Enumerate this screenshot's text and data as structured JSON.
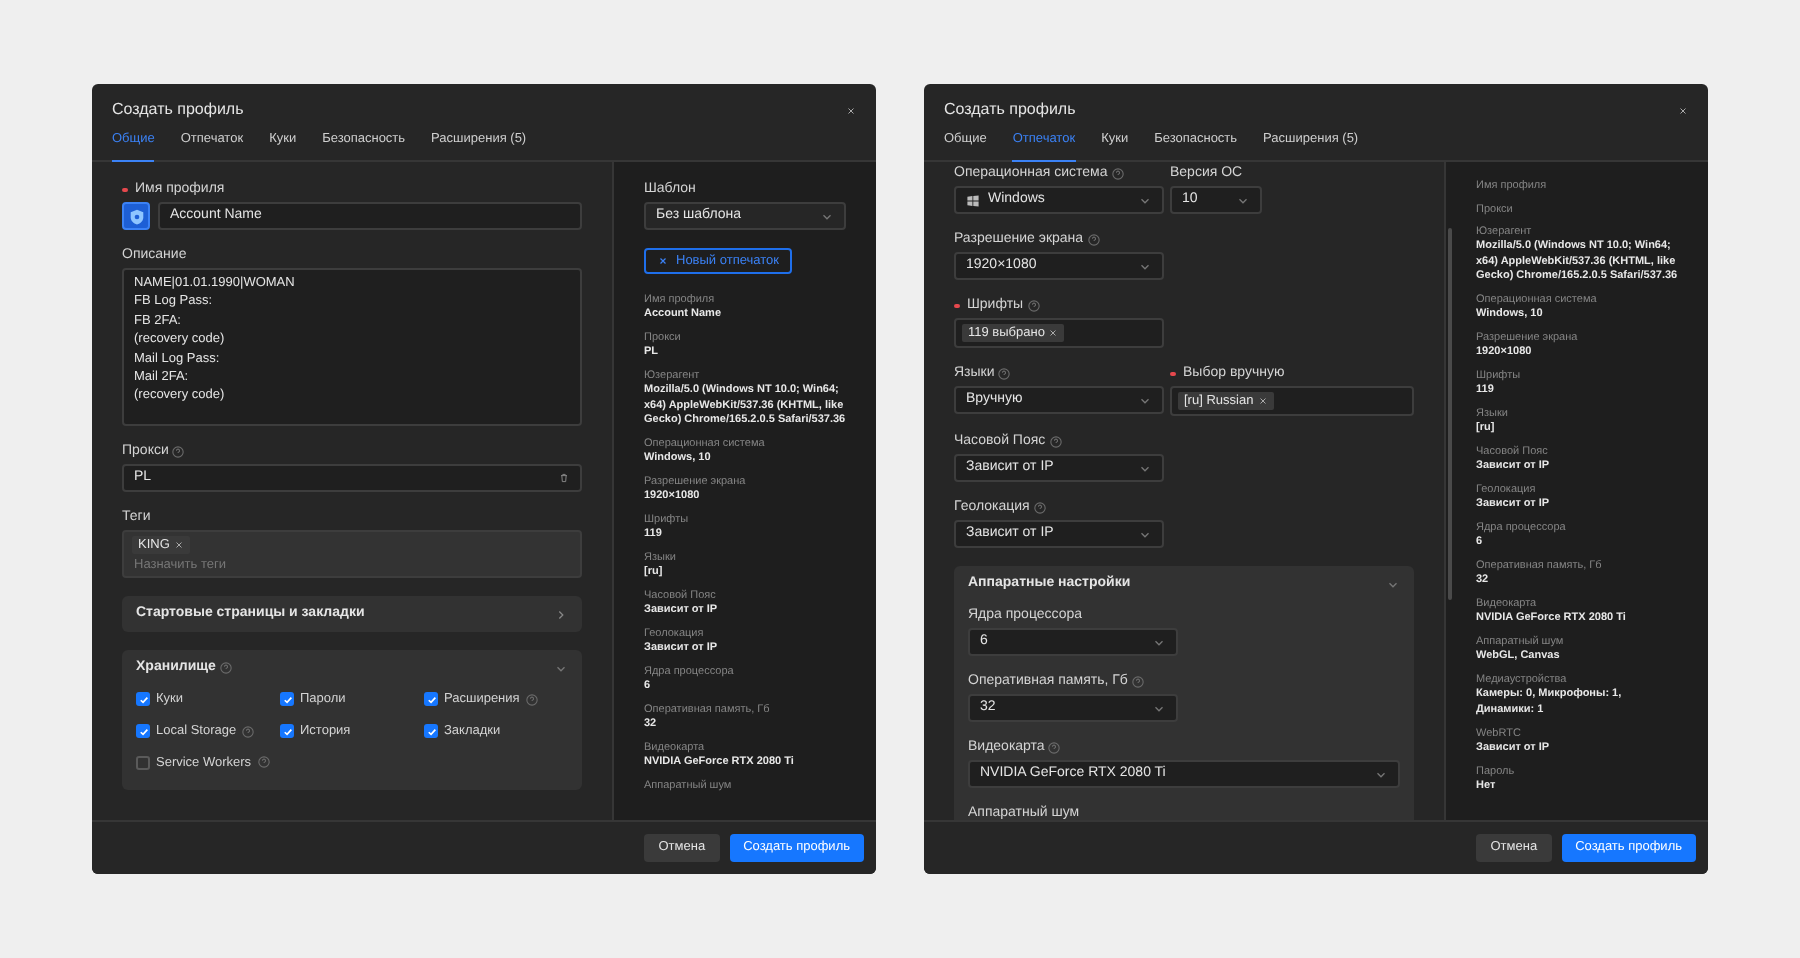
{
  "dialogs": [
    {
      "title": "Создать профиль",
      "tabs": [
        {
          "label": "Общие",
          "selected": true
        },
        {
          "label": "Отпечаток",
          "selected": false
        },
        {
          "label": "Куки",
          "selected": false
        },
        {
          "label": "Безопасность",
          "selected": false
        },
        {
          "label": "Расширения (5)",
          "selected": false
        }
      ],
      "form": [
        [
          {
            "kind": "profile-name",
            "label": "Имя профиля",
            "required": true,
            "value": "Account Name"
          }
        ],
        [
          {
            "kind": "textarea",
            "label": "Описание",
            "value": "NAME|01.01.1990|WOMAN\nFB Log Pass:\nFB 2FA:\n(recovery code)\nMail Log Pass:\nMail 2FA:\n(recovery code)"
          }
        ],
        [
          {
            "kind": "proxy",
            "label": "Прокси",
            "help": true,
            "value": "PL"
          }
        ],
        [
          {
            "kind": "tags",
            "label": "Теги",
            "tags": [
              "KING"
            ],
            "placeholder": "Назначить теги"
          }
        ],
        [
          {
            "kind": "section",
            "title": "Стартовые страницы и закладки",
            "expanded": false
          }
        ],
        [
          {
            "kind": "section",
            "title": "Хранилище",
            "help": true,
            "expanded": true,
            "checkboxes": [
              {
                "label": "Куки",
                "checked": true
              },
              {
                "label": "Пароли",
                "checked": true
              },
              {
                "label": "Расширения",
                "checked": true,
                "help": true
              },
              {
                "label": "Local Storage",
                "checked": true,
                "help": true
              },
              {
                "label": "История",
                "checked": true
              },
              {
                "label": "Закладки",
                "checked": true
              },
              {
                "label": "Service Workers",
                "checked": false,
                "help": true
              }
            ]
          }
        ]
      ],
      "summary": {
        "template": {
          "label": "Шаблон",
          "value": "Без шаблона"
        },
        "new_fingerprint_button": "Новый отпечаток",
        "items": [
          {
            "label": "Имя профиля",
            "value": "Account Name"
          },
          {
            "label": "Прокси",
            "value": "PL"
          },
          {
            "label": "Юзерагент",
            "value": "Mozilla/5.0 (Windows NT 10.0; Win64; x64) AppleWebKit/537.36 (KHTML, like Gecko) Chrome/165.2.0.5 Safari/537.36"
          },
          {
            "label": "Операционная система",
            "value": "Windows, 10"
          },
          {
            "label": "Разрешение экрана",
            "value": "1920×1080"
          },
          {
            "label": "Шрифты",
            "value": "119"
          },
          {
            "label": "Языки",
            "value": "[ru]"
          },
          {
            "label": "Часовой Пояс",
            "value": "Зависит от IP"
          },
          {
            "label": "Геолокация",
            "value": "Зависит от IP"
          },
          {
            "label": "Ядра процессора",
            "value": "6"
          },
          {
            "label": "Оперативная память, Гб",
            "value": "32"
          },
          {
            "label": "Видеокарта",
            "value": "NVIDIA GeForce RTX 2080 Ti"
          },
          {
            "label": "Аппаратный шум"
          }
        ]
      },
      "buttons": [
        {
          "label": "Отмена",
          "kind": "secondary"
        },
        {
          "label": "Создать профиль",
          "kind": "primary"
        }
      ]
    },
    {
      "title": "Создать профиль",
      "tabs": [
        {
          "label": "Общие",
          "selected": false
        },
        {
          "label": "Отпечаток",
          "selected": true
        },
        {
          "label": "Куки",
          "selected": false
        },
        {
          "label": "Безопасность",
          "selected": false
        },
        {
          "label": "Расширения (5)",
          "selected": false
        }
      ],
      "form": [
        [
          {
            "kind": "select-os",
            "label": "Операционная система",
            "help": true,
            "value": "Windows"
          },
          {
            "kind": "select-small",
            "label": "Версия ОС",
            "value": "10"
          }
        ],
        [
          {
            "kind": "select",
            "label": "Разрешение экрана",
            "help": true,
            "value": "1920×1080"
          }
        ],
        [
          {
            "kind": "tag-select",
            "label": "Шрифты",
            "required": true,
            "help": true,
            "tags": [
              "119 выбрано"
            ]
          }
        ],
        [
          {
            "kind": "select",
            "label": "Языки",
            "help": true,
            "value": "Вручную"
          },
          {
            "kind": "tag-select",
            "label": "Выбор вручную",
            "required": true,
            "tags": [
              "[ru] Russian"
            ]
          }
        ],
        [
          {
            "kind": "select",
            "label": "Часовой Пояс",
            "help": true,
            "value": "Зависит от IP"
          }
        ],
        [
          {
            "kind": "select",
            "label": "Геолокация",
            "help": true,
            "value": "Зависит от IP"
          }
        ],
        [
          {
            "kind": "section",
            "title": "Аппаратные настройки",
            "expanded": true,
            "form": [
              [
                {
                  "kind": "select",
                  "label": "Ядра процессора",
                  "value": "6"
                }
              ],
              [
                {
                  "kind": "select",
                  "label": "Оперативная память, Гб",
                  "help": true,
                  "value": "32"
                }
              ],
              [
                {
                  "kind": "select-wide",
                  "label": "Видеокарта",
                  "help": true,
                  "value": "NVIDIA GeForce RTX 2080 Ti"
                }
              ],
              [
                {
                  "kind": "select",
                  "label": "Аппаратный шум"
                }
              ]
            ]
          }
        ]
      ],
      "summary": {
        "items": [
          {
            "label": "Имя профиля"
          },
          {
            "label": "Прокси"
          },
          {
            "label": "Юзерагент",
            "value": "Mozilla/5.0 (Windows NT 10.0; Win64; x64) AppleWebKit/537.36 (KHTML, like Gecko) Chrome/165.2.0.5 Safari/537.36"
          },
          {
            "label": "Операционная система",
            "value": "Windows, 10"
          },
          {
            "label": "Разрешение экрана",
            "value": "1920×1080"
          },
          {
            "label": "Шрифты",
            "value": "119"
          },
          {
            "label": "Языки",
            "value": "[ru]"
          },
          {
            "label": "Часовой Пояс",
            "value": "Зависит от IP"
          },
          {
            "label": "Геолокация",
            "value": "Зависит от IP"
          },
          {
            "label": "Ядра процессора",
            "value": "6"
          },
          {
            "label": "Оперативная память, Гб",
            "value": "32"
          },
          {
            "label": "Видеокарта",
            "value": "NVIDIA GeForce RTX 2080 Ti"
          },
          {
            "label": "Аппаратный шум",
            "value": "WebGL, Canvas"
          },
          {
            "label": "Медиаустройства",
            "value": "Камеры: 0, Микрофоны: 1, Динамики: 1"
          },
          {
            "label": "WebRTC",
            "value": "Зависит от IP"
          },
          {
            "label": "Пароль",
            "value": "Нет"
          }
        ]
      },
      "buttons": [
        {
          "label": "Отмена",
          "kind": "secondary"
        },
        {
          "label": "Создать профиль",
          "kind": "primary"
        }
      ]
    }
  ]
}
